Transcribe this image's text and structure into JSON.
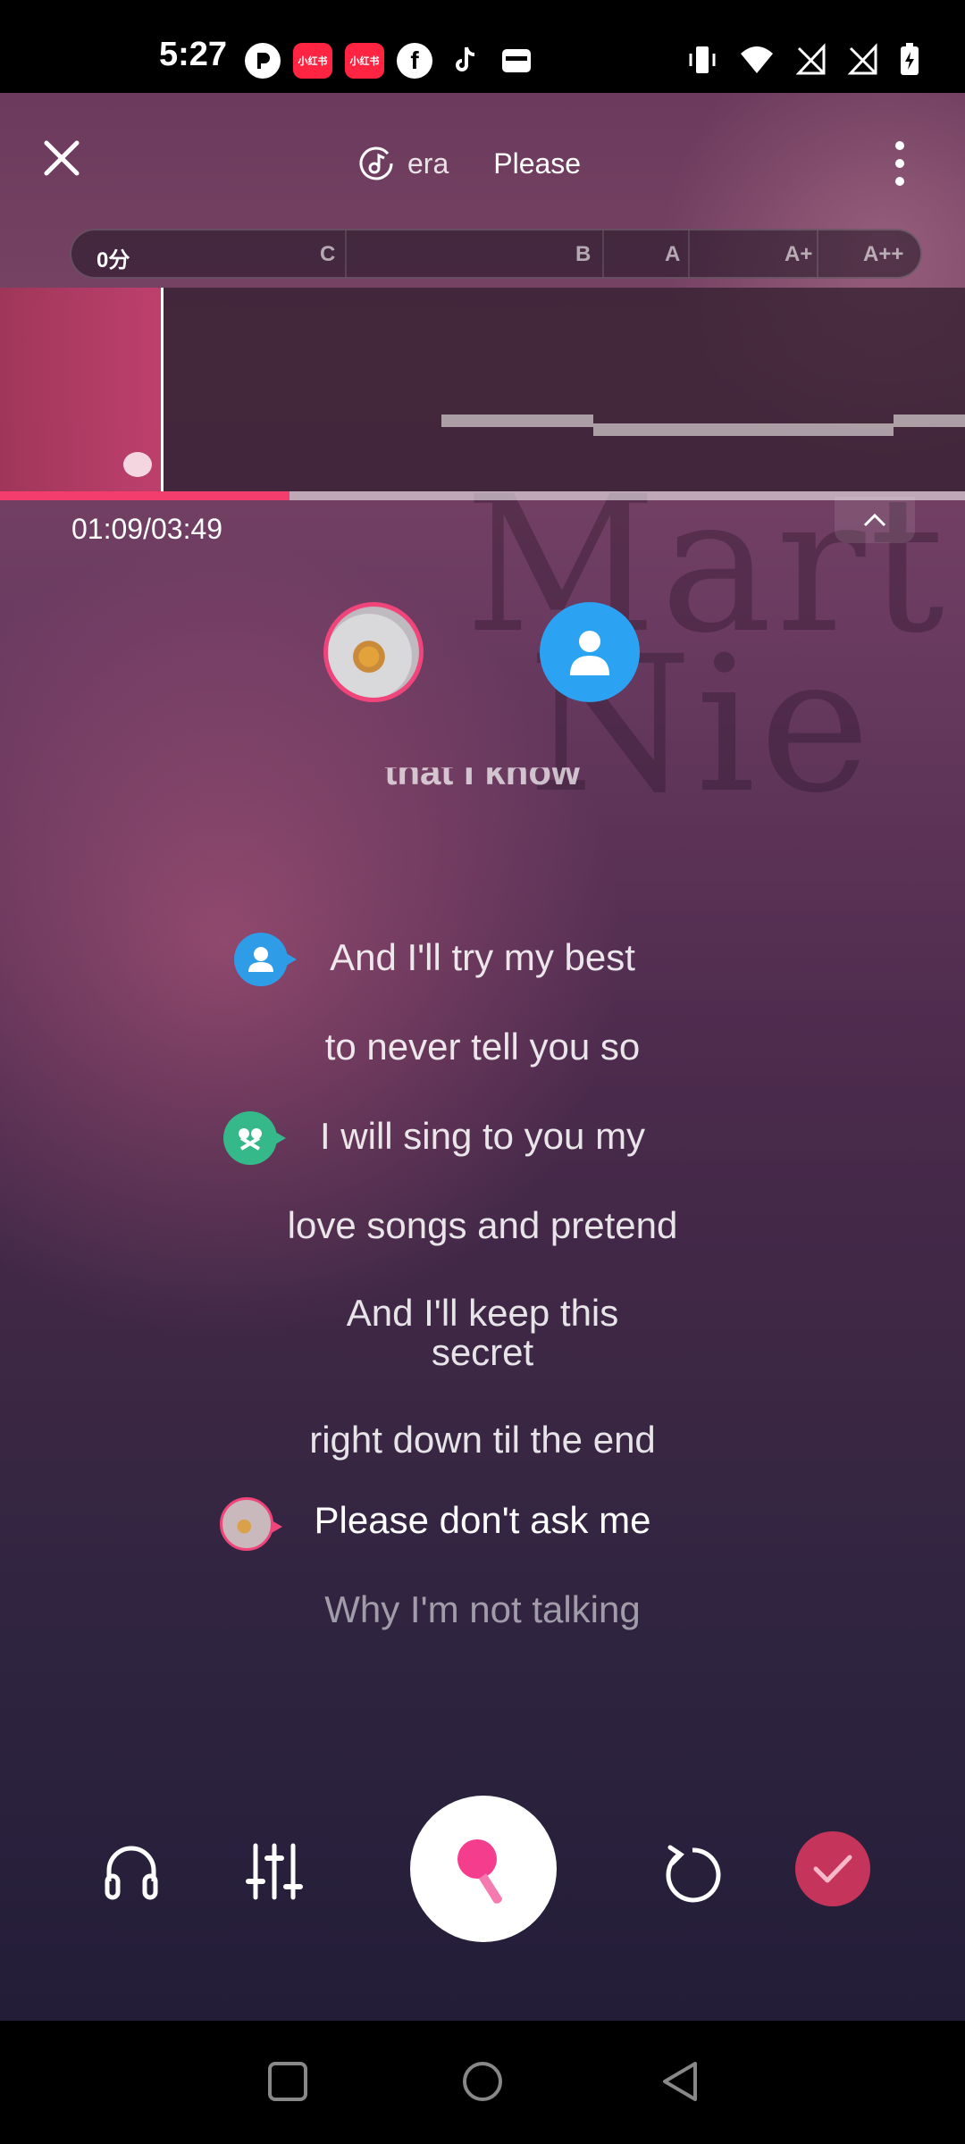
{
  "status": {
    "time": "5:27",
    "app_icons": [
      "pocket-icon",
      "xiaohongshu-icon",
      "xiaohongshu-icon",
      "facebook-icon",
      "tiktok-icon",
      "wallet-icon"
    ],
    "app_icon_labels": [
      "小红书",
      "小红书"
    ],
    "system_icons": [
      "vibrate-icon",
      "wifi-icon",
      "no-signal-icon",
      "no-signal-icon",
      "battery-charging-icon"
    ]
  },
  "header": {
    "tabs": [
      {
        "label": "era",
        "icon": "music-note-icon"
      },
      {
        "label": "Please"
      }
    ]
  },
  "score_bar": {
    "score": "0分",
    "grades": [
      "C",
      "B",
      "A",
      "A+",
      "A++"
    ]
  },
  "playback": {
    "time": "01:09/03:49",
    "progress": 0.3
  },
  "lyrics": {
    "partial_top": "that I know",
    "lines": [
      "And I'll try my best",
      "to never tell you so",
      "I will sing to you my",
      "love songs and pretend",
      "And I'll keep this",
      "secret",
      "right down til the end",
      "Please don't ask me",
      "Why I'm not talking"
    ]
  },
  "controls": {
    "icons": [
      "headphones-icon",
      "equalizer-icon",
      "microphone-icon",
      "restart-icon",
      "checkmark-icon"
    ]
  },
  "colors": {
    "accent": "#f23d6d",
    "singer_blue": "#2ba3f2",
    "done_red": "#c4345b"
  }
}
